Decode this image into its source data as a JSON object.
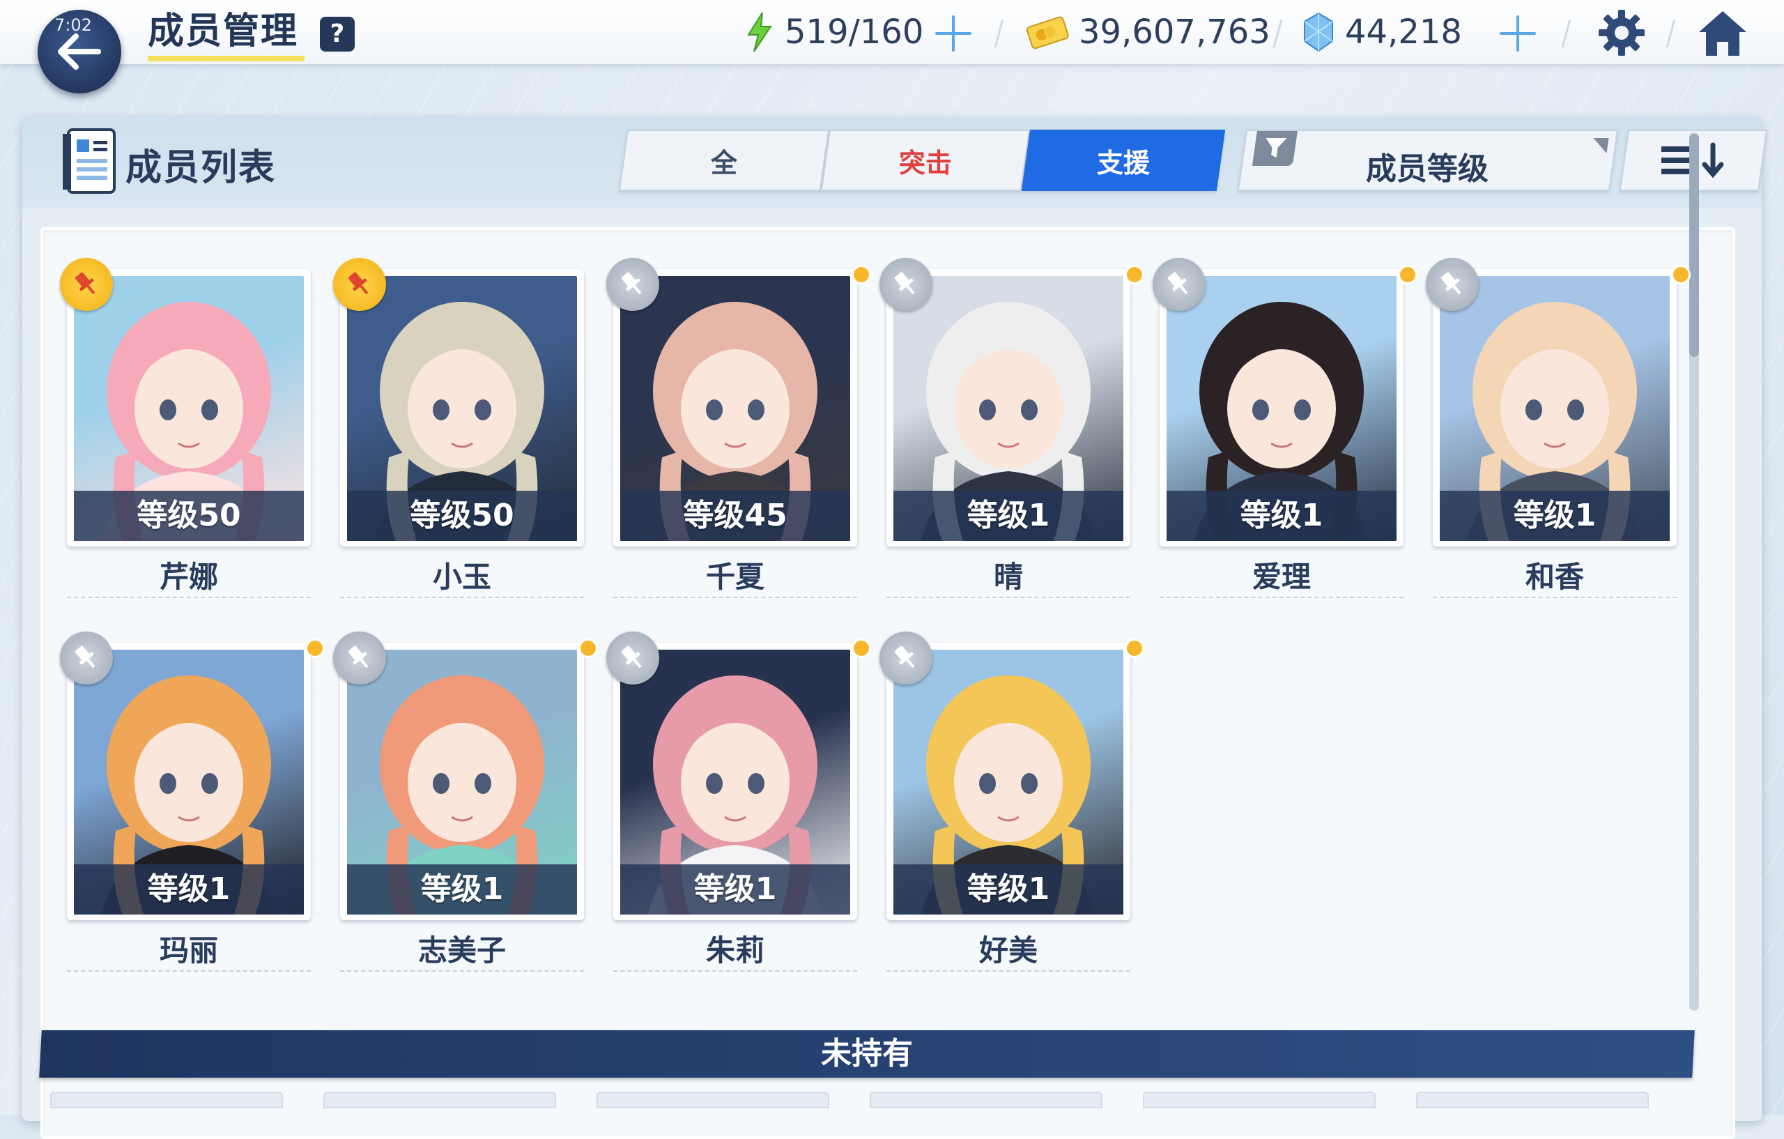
{
  "status": {
    "time": "7:02"
  },
  "header": {
    "title": "成员管理",
    "help_label": "?",
    "resources": [
      {
        "icon": "lightning-icon",
        "value": "519/160",
        "has_plus": true
      },
      {
        "icon": "credit-card-icon",
        "value": "39,607,763",
        "has_plus": false
      },
      {
        "icon": "pyroxene-gem-icon",
        "value": "44,218",
        "has_plus": true
      }
    ]
  },
  "panel": {
    "title": "成员列表",
    "tabs": [
      {
        "label": "全",
        "selected": false
      },
      {
        "label": "突击",
        "selected": false
      },
      {
        "label": "支援",
        "selected": true
      }
    ],
    "sort_label": "成员等级"
  },
  "members": [
    {
      "name": "芹娜",
      "level": "等级50",
      "pinned": true,
      "new_dot": false,
      "palette": [
        "#9fd0ea",
        "#f6a9b8",
        "#ffe3e0"
      ]
    },
    {
      "name": "小玉",
      "level": "等级50",
      "pinned": true,
      "new_dot": false,
      "palette": [
        "#3f5d8c",
        "#d9d2bf",
        "#222c3a"
      ]
    },
    {
      "name": "千夏",
      "level": "等级45",
      "pinned": false,
      "new_dot": true,
      "palette": [
        "#2b3550",
        "#e6b6a8",
        "#3a3a40"
      ]
    },
    {
      "name": "晴",
      "level": "等级1",
      "pinned": false,
      "new_dot": true,
      "palette": [
        "#d7dde6",
        "#eeeeee",
        "#2d3444"
      ]
    },
    {
      "name": "爱理",
      "level": "等级1",
      "pinned": false,
      "new_dot": true,
      "palette": [
        "#a9d1ef",
        "#2a2224",
        "#283044"
      ]
    },
    {
      "name": "和香",
      "level": "等级1",
      "pinned": false,
      "new_dot": true,
      "palette": [
        "#a6c4e6",
        "#f4d6b6",
        "#46505e"
      ]
    },
    {
      "name": "玛丽",
      "level": "等级1",
      "pinned": false,
      "new_dot": true,
      "palette": [
        "#7fa7d6",
        "#f0a658",
        "#1e1e24"
      ]
    },
    {
      "name": "志美子",
      "level": "等级1",
      "pinned": false,
      "new_dot": true,
      "palette": [
        "#8fb3cf",
        "#f09a7a",
        "#7fd3c3"
      ]
    },
    {
      "name": "朱莉",
      "level": "等级1",
      "pinned": false,
      "new_dot": true,
      "palette": [
        "#27324f",
        "#e79aa8",
        "#f4f4f6"
      ]
    },
    {
      "name": "好美",
      "level": "等级1",
      "pinned": false,
      "new_dot": true,
      "palette": [
        "#9cc4e4",
        "#f4c658",
        "#2b2b30"
      ]
    }
  ],
  "unowned_label": "未持有"
}
